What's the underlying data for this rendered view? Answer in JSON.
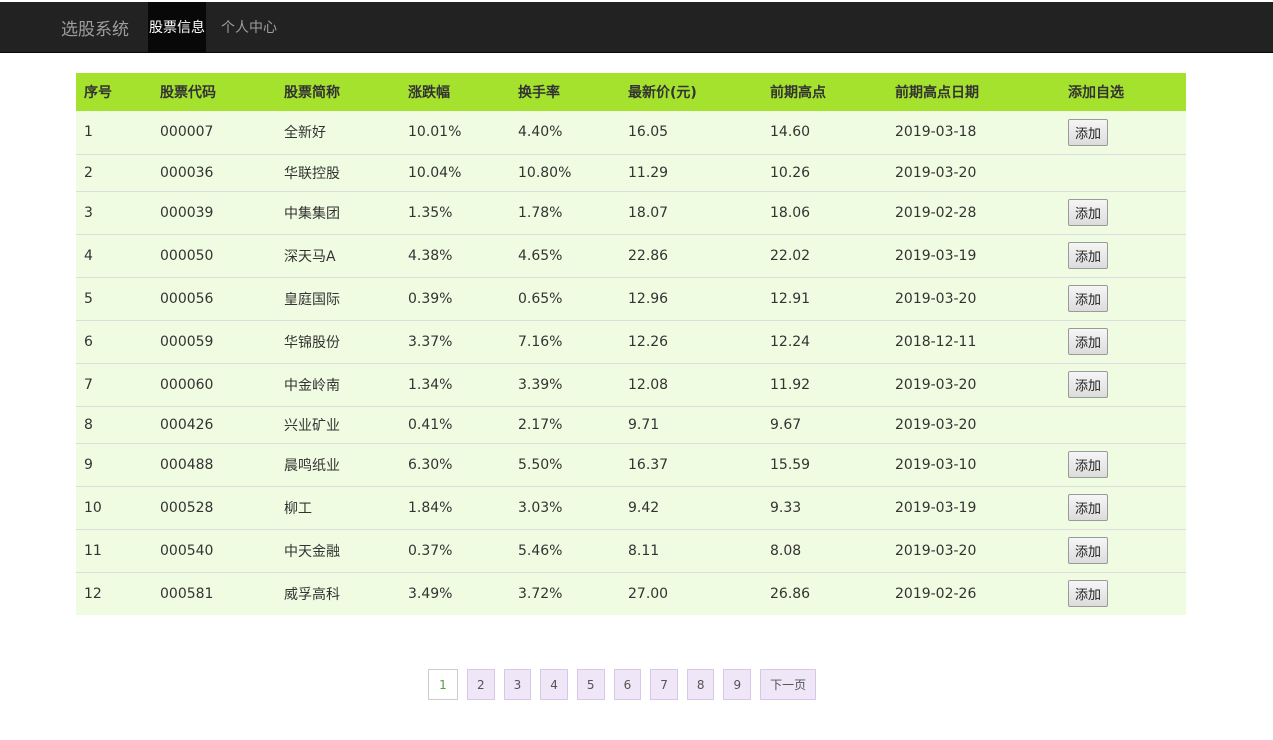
{
  "navbar": {
    "brand": "选股系统",
    "items": [
      {
        "label": "股票信息",
        "active": true
      },
      {
        "label": "个人中心",
        "active": false
      }
    ]
  },
  "table": {
    "headers": [
      "序号",
      "股票代码",
      "股票简称",
      "涨跌幅",
      "换手率",
      "最新价(元)",
      "前期高点",
      "前期高点日期",
      "添加自选"
    ],
    "add_label": "添加",
    "rows": [
      {
        "no": "1",
        "code": "000007",
        "name": "全新好",
        "change": "10.01%",
        "turnover": "4.40%",
        "price": "16.05",
        "high": "14.60",
        "high_date": "2019-03-18",
        "has_add": true
      },
      {
        "no": "2",
        "code": "000036",
        "name": "华联控股",
        "change": "10.04%",
        "turnover": "10.80%",
        "price": "11.29",
        "high": "10.26",
        "high_date": "2019-03-20",
        "has_add": false
      },
      {
        "no": "3",
        "code": "000039",
        "name": "中集集团",
        "change": "1.35%",
        "turnover": "1.78%",
        "price": "18.07",
        "high": "18.06",
        "high_date": "2019-02-28",
        "has_add": true
      },
      {
        "no": "4",
        "code": "000050",
        "name": "深天马A",
        "change": "4.38%",
        "turnover": "4.65%",
        "price": "22.86",
        "high": "22.02",
        "high_date": "2019-03-19",
        "has_add": true
      },
      {
        "no": "5",
        "code": "000056",
        "name": "皇庭国际",
        "change": "0.39%",
        "turnover": "0.65%",
        "price": "12.96",
        "high": "12.91",
        "high_date": "2019-03-20",
        "has_add": true
      },
      {
        "no": "6",
        "code": "000059",
        "name": "华锦股份",
        "change": "3.37%",
        "turnover": "7.16%",
        "price": "12.26",
        "high": "12.24",
        "high_date": "2018-12-11",
        "has_add": true
      },
      {
        "no": "7",
        "code": "000060",
        "name": "中金岭南",
        "change": "1.34%",
        "turnover": "3.39%",
        "price": "12.08",
        "high": "11.92",
        "high_date": "2019-03-20",
        "has_add": true
      },
      {
        "no": "8",
        "code": "000426",
        "name": "兴业矿业",
        "change": "0.41%",
        "turnover": "2.17%",
        "price": "9.71",
        "high": "9.67",
        "high_date": "2019-03-20",
        "has_add": false
      },
      {
        "no": "9",
        "code": "000488",
        "name": "晨鸣纸业",
        "change": "6.30%",
        "turnover": "5.50%",
        "price": "16.37",
        "high": "15.59",
        "high_date": "2019-03-10",
        "has_add": true
      },
      {
        "no": "10",
        "code": "000528",
        "name": "柳工",
        "change": "1.84%",
        "turnover": "3.03%",
        "price": "9.42",
        "high": "9.33",
        "high_date": "2019-03-19",
        "has_add": true
      },
      {
        "no": "11",
        "code": "000540",
        "name": "中天金融",
        "change": "0.37%",
        "turnover": "5.46%",
        "price": "8.11",
        "high": "8.08",
        "high_date": "2019-03-20",
        "has_add": true
      },
      {
        "no": "12",
        "code": "000581",
        "name": "威孚高科",
        "change": "3.49%",
        "turnover": "3.72%",
        "price": "27.00",
        "high": "26.86",
        "high_date": "2019-02-26",
        "has_add": true
      }
    ]
  },
  "pagination": {
    "current": "1",
    "pages": [
      "1",
      "2",
      "3",
      "4",
      "5",
      "6",
      "7",
      "8",
      "9"
    ],
    "next_label": "下一页"
  },
  "colors": {
    "header_bg": "#a5e22e",
    "row_bg": "#f0fce2",
    "navbar_bg": "#222222",
    "page_bg": "#efe6f8"
  }
}
